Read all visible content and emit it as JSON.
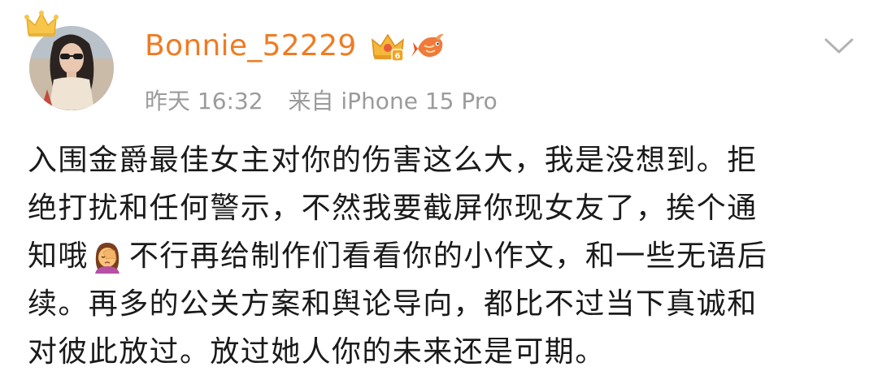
{
  "post": {
    "author": {
      "name": "Bonnie_52229",
      "avatar_icon": "avatar-photo",
      "crown_icon": "crown-icon",
      "vip_badge_icon": "vip-level-badge-icon",
      "fish_badge_icon": "koi-badge-icon"
    },
    "meta": {
      "time": "昨天 16:32",
      "source": "来自 iPhone 15 Pro"
    },
    "menu_icon": "chevron-down-icon",
    "content_lines": [
      {
        "text": "入围金爵最佳女主对你的伤害这么大，我是没想到。拒"
      },
      {
        "text": "绝打扰和任何警示，不然我要截屏你现女友了，挨个通"
      },
      {
        "before": "知哦",
        "emoji": "facepalm-woman-emoji",
        "after": "不行再给制作们看看你的小作文，和一些无语后"
      },
      {
        "text": "续。再多的公关方案和舆论导向，都比不过当下真诚和"
      },
      {
        "text": "对彼此放过。放过她人你的未来还是可期。"
      }
    ],
    "colors": {
      "username": "#f07b22",
      "meta": "#9b9b9b",
      "body_text": "#1a1a1a",
      "background": "#ffffff"
    }
  }
}
